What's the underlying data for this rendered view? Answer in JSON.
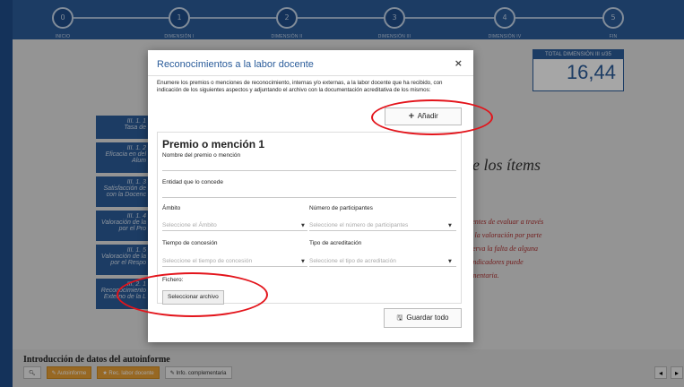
{
  "steps": [
    {
      "num": "0",
      "label": "INICIO"
    },
    {
      "num": "1",
      "label": "DIMENSIÓN I"
    },
    {
      "num": "2",
      "label": "DIMENSIÓN II"
    },
    {
      "num": "3",
      "label": "DIMENSIÓN III"
    },
    {
      "num": "4",
      "label": "DIMENSIÓN IV"
    },
    {
      "num": "5",
      "label": "FIN"
    }
  ],
  "total": {
    "label": "TOTAL DIMENSIÓN III s/35",
    "value": "16,44"
  },
  "tiles": [
    {
      "code": "III. 1. 1",
      "text": "Tasa de"
    },
    {
      "code": "III. 1. 2",
      "text": "Eficacia en del Alum"
    },
    {
      "code": "III. 1. 3",
      "text": "Satisfacción de con la Docenc"
    },
    {
      "code": "III. 1. 4",
      "text": "Valoración de la por el Pro"
    },
    {
      "code": "III. 1. 5",
      "text": "Valoración de la por el Respo"
    },
    {
      "code": "III. 2. 1",
      "text": "Reconocimiento Externo de la L"
    }
  ],
  "background": {
    "heading": "de los ítems",
    "heading2": "s",
    "text_lines": [
      "dientes de evaluar a través",
      "de la valoración por parte",
      "bserva la falta de alguna",
      "s indicadores puede",
      "lementaria."
    ]
  },
  "bottom": {
    "title": "Introducción de datos del autoinforme",
    "buttons": [
      "Autoinforme",
      "Rec. labor docente",
      "Info. complementaria"
    ]
  },
  "modal": {
    "title": "Reconocimientos a la labor docente",
    "close": "×",
    "description": "Enumere los premios o menciones de reconocimiento, internas y/o externas, a la labor docente que ha recibido, con indicación de los siguientes aspectos y adjuntando el archivo con la documentación acreditativa de los mismos:",
    "add_label": "Añadir",
    "card_title": "Premio o mención 1",
    "fields": {
      "name_label": "Nombre del premio o mención",
      "entity_label": "Entidad que lo concede",
      "scope_label": "Ámbito",
      "scope_placeholder": "Seleccione el Ámbito",
      "participants_label": "Número de participantes",
      "participants_placeholder": "Seleccione el número de participantes",
      "time_label": "Tiempo de concesión",
      "time_placeholder": "Seleccione el tiempo de concesión",
      "accr_label": "Tipo de acreditación",
      "accr_placeholder": "Seleccione el tipo de acreditación",
      "file_label": "Fichero:",
      "file_button": "Seleccionar archivo"
    },
    "save_label": "Guardar todo"
  },
  "colors": {
    "primary": "#2b5c9a",
    "annotation": "#e3141b",
    "orange": "#e8a037"
  },
  "icons": {
    "add": "plus-icon",
    "save": "floppy-icon",
    "close": "close-icon",
    "search": "search-icon"
  }
}
